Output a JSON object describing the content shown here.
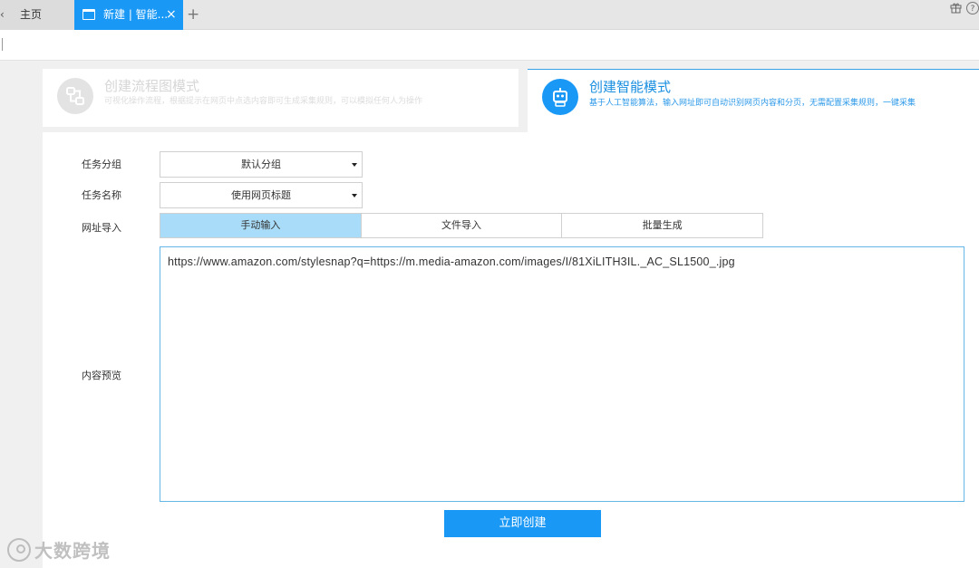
{
  "tabs": {
    "home_label": "主页",
    "active_label": "新建 | 智能...",
    "close_glyph": "×",
    "add_glyph": "+"
  },
  "top_icons": [
    "gift-icon",
    "help-icon"
  ],
  "modes": {
    "flow": {
      "title": "创建流程图模式",
      "description": "可视化操作流程，根据提示在网页中点选内容即可生成采集规则，可以模拟任何人为操作"
    },
    "smart": {
      "title": "创建智能模式",
      "description": "基于人工智能算法，输入网址即可自动识别网页内容和分页，无需配置采集规则，一键采集"
    }
  },
  "form": {
    "group_label": "任务分组",
    "group_value": "默认分组",
    "name_label": "任务名称",
    "name_value": "使用网页标题",
    "url_import_label": "网址导入",
    "import_tabs": [
      "手动输入",
      "文件导入",
      "批量生成"
    ],
    "active_import_tab": 0,
    "content_label": "内容预览",
    "content_value": "https://www.amazon.com/stylesnap?q=https://m.media-amazon.com/images/I/81XiLITH3IL._AC_SL1500_.jpg",
    "create_button": "立即创建"
  },
  "watermark": "大数跨境",
  "colors": {
    "accent": "#1a98f5",
    "active_segment": "#a8dcf8"
  }
}
